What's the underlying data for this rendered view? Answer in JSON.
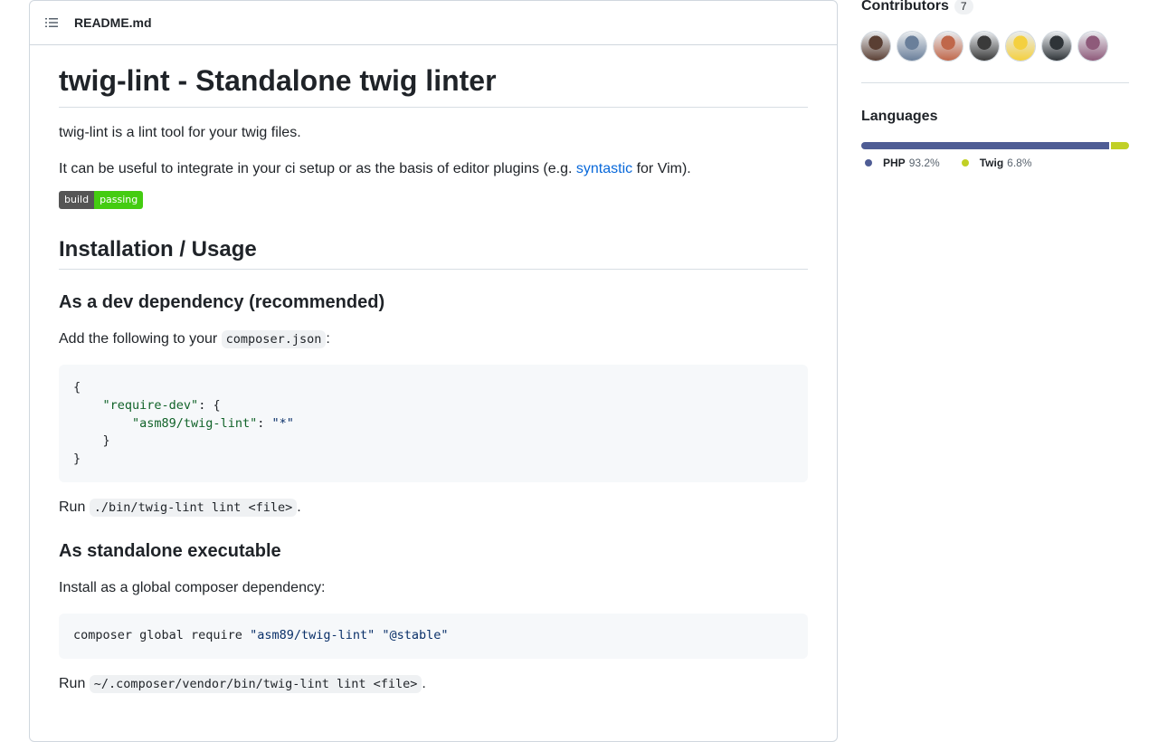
{
  "readme": {
    "file_name": "README.md",
    "title": "twig-lint - Standalone twig linter",
    "intro": "twig-lint is a lint tool for your twig files.",
    "useful_pre": "It can be useful to integrate in your ci setup or as the basis of editor plugins (e.g. ",
    "useful_link": "syntastic",
    "useful_post": " for Vim).",
    "badge": {
      "left": "build",
      "right": "passing",
      "left_color": "#555555",
      "right_color": "#44cc11"
    },
    "install_heading": "Installation / Usage",
    "dev_heading": "As a dev dependency (recommended)",
    "add_pre": "Add the following to your ",
    "add_code": "composer.json",
    "add_post": ":",
    "composer_block": {
      "open": "{",
      "require_key": "\"require-dev\"",
      "require_rest": ": {",
      "pkg_key": "\"asm89/twig-lint\"",
      "pkg_sep": ": ",
      "pkg_val": "\"*\"",
      "inner_close": "}",
      "close": "}"
    },
    "run1_pre": "Run ",
    "run1_code": "./bin/twig-lint lint <file>",
    "run1_post": ".",
    "standalone_heading": "As standalone executable",
    "global_text": "Install as a global composer dependency:",
    "global_cmd": {
      "prefix": "composer global require ",
      "pkg": "\"asm89/twig-lint\"",
      "space": " ",
      "ver": "\"@stable\""
    },
    "run2_pre": "Run ",
    "run2_code": "~/.composer/vendor/bin/twig-lint lint <file>",
    "run2_post": "."
  },
  "sidebar": {
    "contributors_title": "Contributors",
    "contributors_count": "7",
    "avatar_colors": [
      "#5a3f33",
      "#6a7f9a",
      "#c0674a",
      "#3a3a3a",
      "#f4d03f",
      "#2f3438",
      "#8e5a7a"
    ],
    "languages_title": "Languages",
    "languages": [
      {
        "name": "PHP",
        "percent": "93.2%",
        "share": 93.2,
        "color": "#4F5D95"
      },
      {
        "name": "Twig",
        "percent": "6.8%",
        "share": 6.8,
        "color": "#c1d026"
      }
    ]
  }
}
